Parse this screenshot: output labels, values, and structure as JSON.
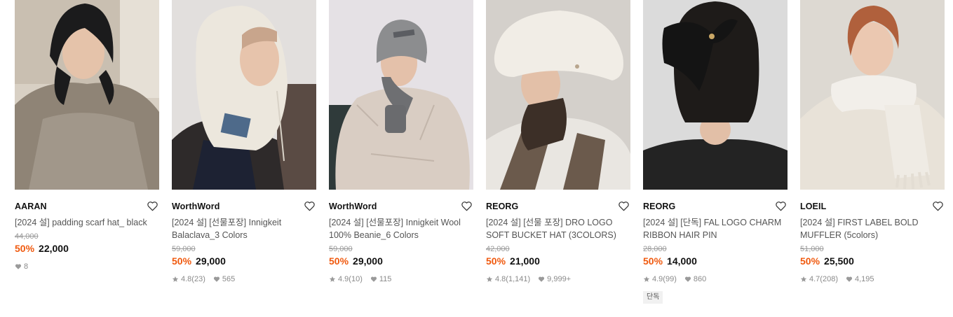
{
  "products": [
    {
      "brand": "AARAN",
      "title": "[2024 설] padding scarf hat_ black",
      "original_price": "44,000",
      "discount": "50%",
      "price": "22,000",
      "likes": "8",
      "image": {
        "bg": "#d9d2c8",
        "subject": "woman in black scarf hat and fleece coat"
      }
    },
    {
      "brand": "WorthWord",
      "title": "[2024 설] [선물포장] Innigkeit Balaclava_3 Colors",
      "original_price": "59,000",
      "discount": "50%",
      "price": "29,000",
      "rating": "4.8",
      "reviews": "(23)",
      "likes": "565",
      "image": {
        "bg": "#e4e0de",
        "subject": "woman in cream knit balaclava"
      }
    },
    {
      "brand": "WorthWord",
      "title": "[2024 설] [선물포장] Innigkeit Wool 100% Beanie_6 Colors",
      "original_price": "59,000",
      "discount": "50%",
      "price": "29,000",
      "rating": "4.9",
      "reviews": "(10)",
      "likes": "115",
      "image": {
        "bg": "#e6e2e6",
        "subject": "woman in grey beanie and puffer jacket"
      }
    },
    {
      "brand": "REORG",
      "title": "[2024 설] [선물 포장] DRO LOGO SOFT BUCKET HAT (3COLORS)",
      "original_price": "42,000",
      "discount": "50%",
      "price": "21,000",
      "rating": "4.8",
      "reviews": "(1,141)",
      "likes": "9,999+",
      "image": {
        "bg": "#d5d1cc",
        "subject": "woman in fluffy ivory bucket hat"
      }
    },
    {
      "brand": "REORG",
      "title": "[2024 설] [단독] FAL LOGO CHARM RIBBON HAIR PIN",
      "original_price": "28,000",
      "discount": "50%",
      "price": "14,000",
      "rating": "4.9",
      "reviews": "(99)",
      "likes": "860",
      "badge": "단독",
      "image": {
        "bg": "#dcdcdc",
        "subject": "black ribbon hair pin on bob haircut"
      }
    },
    {
      "brand": "LOEIL",
      "title": "[2024 설] FIRST LABEL BOLD MUFFLER (5colors)",
      "original_price": "51,000",
      "discount": "50%",
      "price": "25,500",
      "rating": "4.7",
      "reviews": "(208)",
      "likes": "4,195",
      "image": {
        "bg": "#dfdbd4",
        "subject": "woman in fringed ivory muffler"
      }
    }
  ],
  "colors": {
    "discount": "#f05a0f",
    "meta": "#8a8a8a",
    "strike": "#9a9a9a"
  },
  "icons": {
    "wishlist": "heart-outline-icon",
    "rating": "star-icon",
    "likes": "heart-filled-icon"
  }
}
